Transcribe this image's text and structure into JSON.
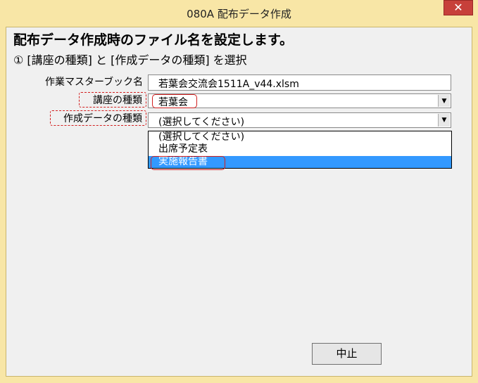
{
  "window": {
    "title": "080A 配布データ作成",
    "close_symbol": "✕"
  },
  "form": {
    "heading": "配布データ作成時のファイル名を設定します。",
    "instruction": "① [講座の種類] と [作成データの種類] を選択",
    "workbook": {
      "label": "作業マスターブック名",
      "value": "若葉会交流会1511A_v44.xlsm"
    },
    "course_type": {
      "label": "講座の種類",
      "value": "若葉会"
    },
    "data_type": {
      "label": "作成データの種類",
      "value": "(選択してください)"
    },
    "dropdown_options": [
      "(選択してください)",
      "出席予定表",
      "実施報告書"
    ],
    "selected_option_index": 2,
    "cancel_label": "中止"
  }
}
